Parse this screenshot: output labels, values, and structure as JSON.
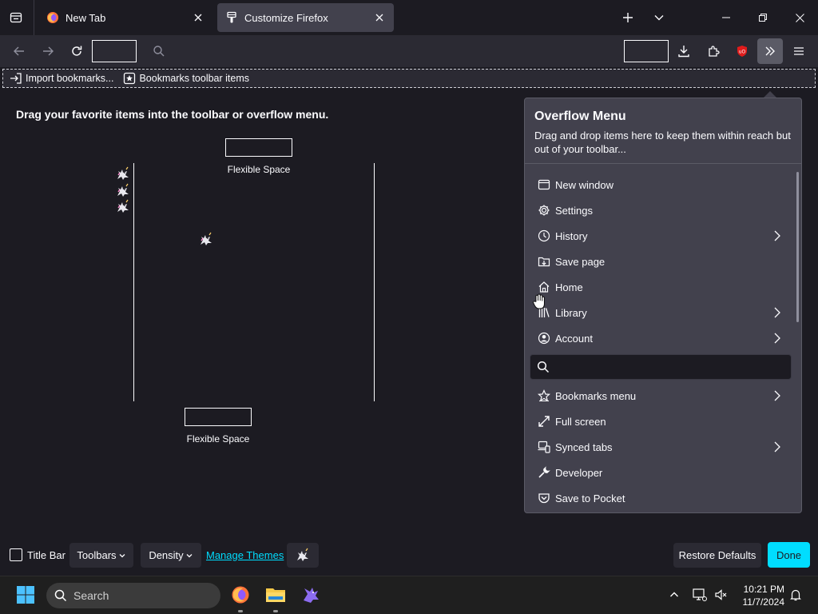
{
  "tabs": [
    {
      "title": "New Tab",
      "active": false
    },
    {
      "title": "Customize Firefox",
      "active": true
    }
  ],
  "bookmarks_toolbar": {
    "items": [
      "Import bookmarks...",
      "Bookmarks toolbar items"
    ]
  },
  "customize": {
    "palette_title": "Drag your favorite items into the toolbar or overflow menu.",
    "flexible_space_label_1": "Flexible Space",
    "flexible_space_label_2": "Flexible Space"
  },
  "overflow_menu": {
    "title": "Overflow Menu",
    "description": "Drag and drop items here to keep them within reach but out of your toolbar...",
    "items": [
      {
        "label": "New window",
        "icon": "window-icon",
        "submenu": false
      },
      {
        "label": "Settings",
        "icon": "gear-icon",
        "submenu": false
      },
      {
        "label": "History",
        "icon": "clock-icon",
        "submenu": true
      },
      {
        "label": "Save page",
        "icon": "save-page-icon",
        "submenu": false
      },
      {
        "label": "Home",
        "icon": "home-icon",
        "submenu": false
      },
      {
        "label": "Library",
        "icon": "library-icon",
        "submenu": true
      },
      {
        "label": "Account",
        "icon": "account-icon",
        "submenu": true
      },
      {
        "label": "Bookmarks menu",
        "icon": "star-icon",
        "submenu": true
      },
      {
        "label": "Full screen",
        "icon": "fullscreen-icon",
        "submenu": false
      },
      {
        "label": "Synced tabs",
        "icon": "synced-tabs-icon",
        "submenu": true
      },
      {
        "label": "Developer",
        "icon": "wrench-icon",
        "submenu": false
      },
      {
        "label": "Save to Pocket",
        "icon": "pocket-icon",
        "submenu": false
      }
    ]
  },
  "footer": {
    "title_bar_label": "Title Bar",
    "toolbars_label": "Toolbars",
    "density_label": "Density",
    "manage_themes_label": "Manage Themes",
    "restore_defaults_label": "Restore Defaults",
    "done_label": "Done"
  },
  "taskbar": {
    "search_label": "Search",
    "time": "10:21 PM",
    "date": "11/7/2024"
  },
  "colors": {
    "background": "#1c1b22",
    "toolbar": "#2b2a33",
    "panel": "#42414d",
    "accent": "#00ddff",
    "ublock_red": "#e01b1b"
  }
}
